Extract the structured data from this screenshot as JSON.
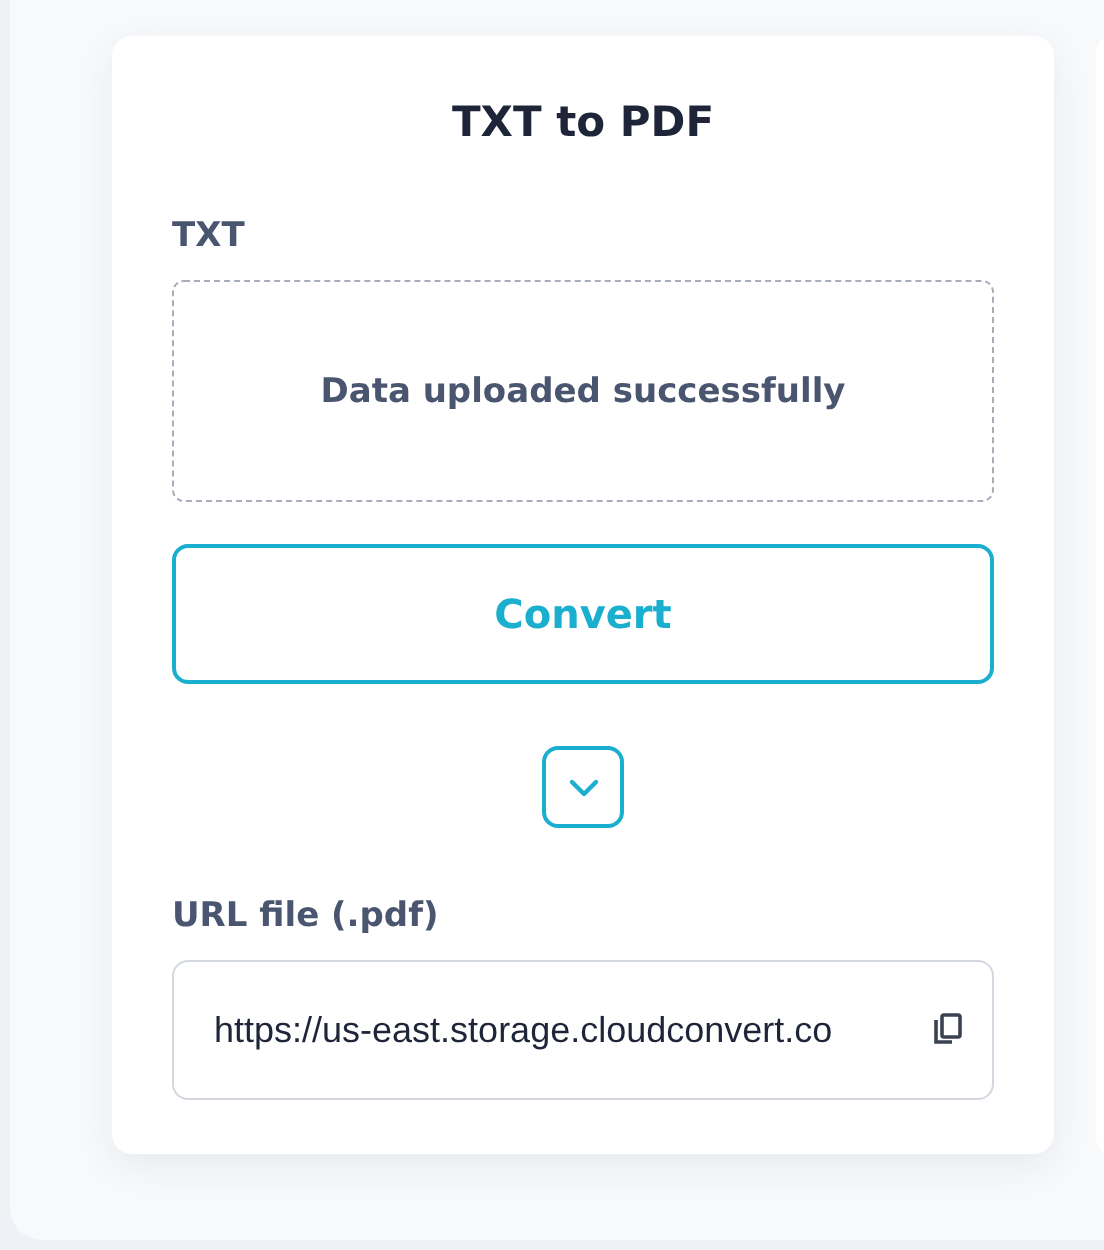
{
  "card": {
    "title": "TXT to PDF",
    "input_label": "TXT",
    "dropzone": {
      "message": "Data uploaded successfully"
    },
    "convert_button": "Convert",
    "output_label": "URL file (.pdf)",
    "output_field": {
      "value": "https://us-east.storage.cloudconvert.co"
    }
  }
}
